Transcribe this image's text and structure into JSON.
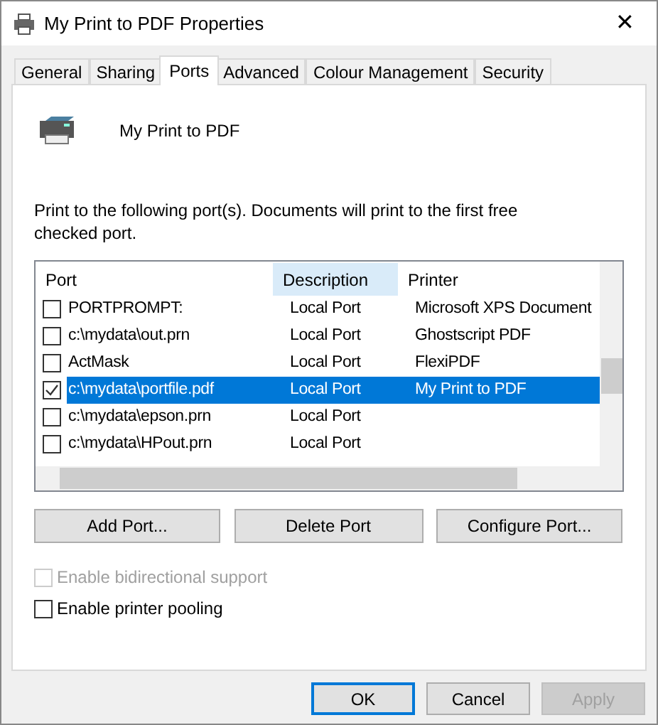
{
  "window": {
    "title": "My Print to PDF Properties",
    "close": "✕"
  },
  "tabs": [
    {
      "label": "General",
      "selected": false
    },
    {
      "label": "Sharing",
      "selected": false
    },
    {
      "label": "Ports",
      "selected": true
    },
    {
      "label": "Advanced",
      "selected": false
    },
    {
      "label": "Colour Management",
      "selected": false
    },
    {
      "label": "Security",
      "selected": false
    }
  ],
  "printer_name": "My Print to PDF",
  "instructions": "Print to the following port(s). Documents will print to the first free checked port.",
  "ports_table": {
    "columns": [
      {
        "label": "Port",
        "highlighted": false
      },
      {
        "label": "Description",
        "highlighted": true
      },
      {
        "label": "Printer",
        "highlighted": false
      }
    ],
    "rows": [
      {
        "port": "PORTPROMPT:",
        "description": "Local Port",
        "printer": "Microsoft XPS Document",
        "checked": false,
        "selected": false
      },
      {
        "port": "c:\\mydata\\out.prn",
        "description": "Local Port",
        "printer": "Ghostscript PDF",
        "checked": false,
        "selected": false
      },
      {
        "port": "ActMask",
        "description": "Local Port",
        "printer": "FlexiPDF",
        "checked": false,
        "selected": false
      },
      {
        "port": "c:\\mydata\\portfile.pdf",
        "description": "Local Port",
        "printer": "My Print to PDF",
        "checked": true,
        "selected": true
      },
      {
        "port": "c:\\mydata\\epson.prn",
        "description": "Local Port",
        "checked": false,
        "selected": false
      },
      {
        "port": "c:\\mydata\\HPout.prn",
        "description": "Local Port",
        "checked": false,
        "selected": false
      }
    ]
  },
  "port_buttons": [
    "Add Port...",
    "Delete Port",
    "Configure Port..."
  ],
  "options": [
    {
      "label": "Enable bidirectional support",
      "checked": false,
      "disabled": true
    },
    {
      "label": "Enable printer pooling",
      "checked": false,
      "disabled": false
    }
  ],
  "dialog_buttons": [
    {
      "label": "OK",
      "default": true,
      "disabled": false
    },
    {
      "label": "Cancel",
      "default": false,
      "disabled": false
    },
    {
      "label": "Apply",
      "default": false,
      "disabled": true
    }
  ]
}
